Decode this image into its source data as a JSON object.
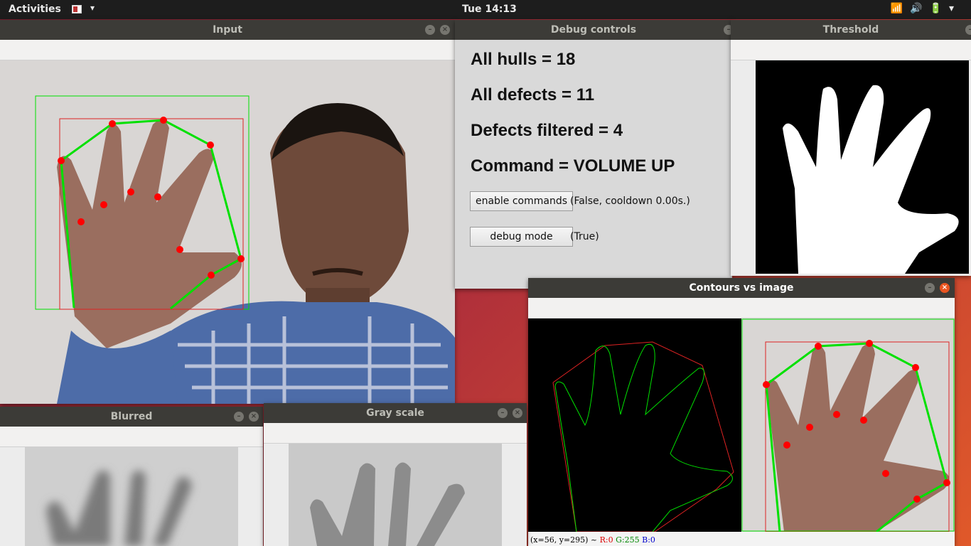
{
  "topbar": {
    "activities": "Activities",
    "clock": "Tue 14:13",
    "tray": "📶🔊🔋▾"
  },
  "windows": {
    "input": {
      "title": "Input"
    },
    "debug": {
      "title": "Debug controls",
      "hulls": "All hulls = 18",
      "defects": "All defects = 11",
      "filtered": "Defects filtered = 4",
      "command": "Command = VOLUME UP",
      "enable_button": "enable commands",
      "enable_status": "(False, cooldown 0.00s.)",
      "debug_button": "debug mode",
      "debug_status": "(True)"
    },
    "threshold": {
      "title": "Threshold"
    },
    "contours": {
      "title": "Contours vs image",
      "status_coords": "(x=56, y=295) ~",
      "status_r": "R:0",
      "status_g": "G:255",
      "status_b": "B:0"
    },
    "blurred": {
      "title": "Blurred"
    },
    "gray": {
      "title": "Gray scale"
    }
  },
  "colors": {
    "hull": "#00e000",
    "defect": "#ff0000",
    "box": "#dd2222",
    "accent": "#e95420"
  }
}
